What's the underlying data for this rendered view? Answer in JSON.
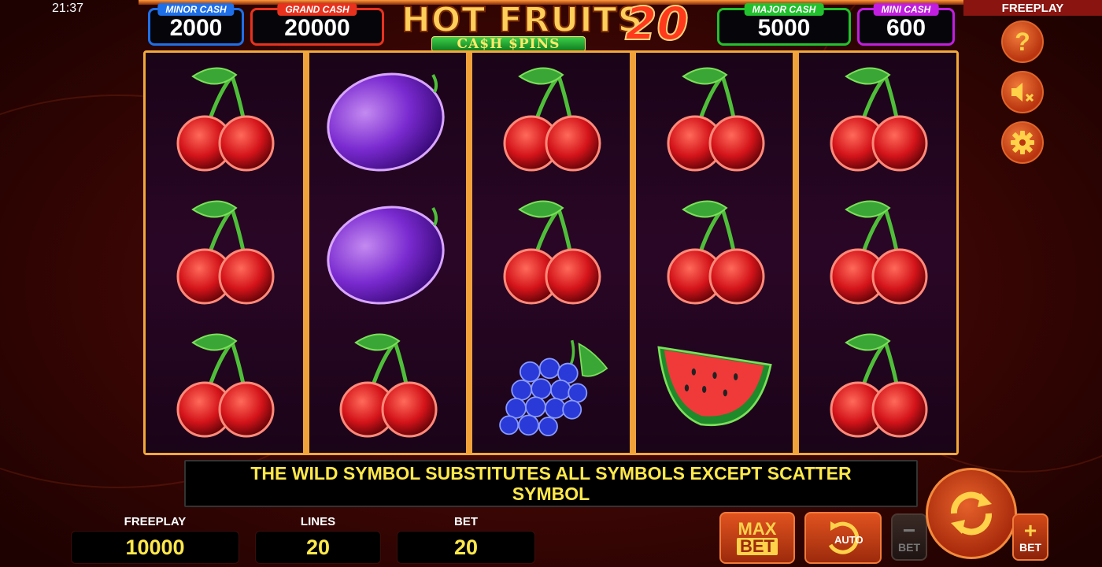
{
  "status": {
    "clock": "21:37",
    "mode": "FREEPLAY"
  },
  "jackpots": [
    {
      "label": "MINOR CASH",
      "value": "2000",
      "color": "#1f6fe8"
    },
    {
      "label": "GRAND CASH",
      "value": "20000",
      "color": "#e8321e"
    },
    {
      "label": "MAJOR CASH",
      "value": "5000",
      "color": "#22c12e"
    },
    {
      "label": "MINI CASH",
      "value": "600",
      "color": "#c21ee0"
    }
  ],
  "logo": {
    "title": "HOT FRUITS",
    "number": "20",
    "subtitle": "CA$H $PINS"
  },
  "reels": [
    [
      "cherry",
      "cherry",
      "cherry"
    ],
    [
      "plum",
      "plum",
      "cherry"
    ],
    [
      "cherry",
      "cherry",
      "grapes"
    ],
    [
      "cherry",
      "cherry",
      "watermelon"
    ],
    [
      "cherry",
      "cherry",
      "cherry"
    ]
  ],
  "message": "THE WILD SYMBOL SUBSTITUTES ALL SYMBOLS EXCEPT SCATTER SYMBOL",
  "counters": {
    "freeplay": {
      "label": "FREEPLAY",
      "value": "10000"
    },
    "lines": {
      "label": "LINES",
      "value": "20"
    },
    "bet": {
      "label": "BET",
      "value": "20"
    }
  },
  "controls": {
    "help": "?",
    "max_bet_line1": "MAX",
    "max_bet_line2": "BET",
    "auto": "AUTO",
    "bet_minus_symbol": "−",
    "bet_minus_label": "BET",
    "bet_plus_symbol": "+",
    "bet_plus_label": "BET",
    "sound_icon": "speaker-muted-icon",
    "settings_icon": "gear-icon",
    "spin_icon": "spin-arrows-icon"
  }
}
